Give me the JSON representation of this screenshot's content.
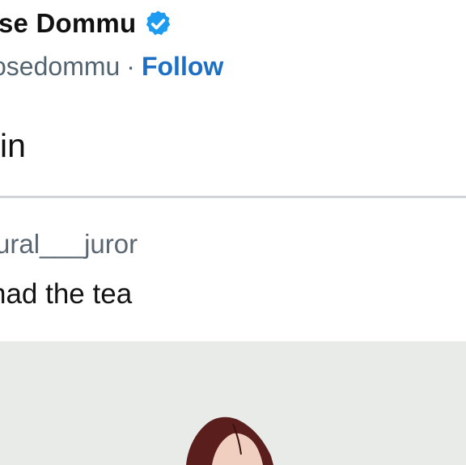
{
  "tweet": {
    "author_name": "se Dommu",
    "author_handle": "osedommu",
    "separator": "·",
    "follow_label": "Follow",
    "verified_icon": "verified-badge-icon",
    "text": "in"
  },
  "quote": {
    "handle": "ural___juror",
    "text": "had the tea"
  },
  "media": {
    "description_icon": "cartoon-illustration",
    "background_color": "#e9ebe8",
    "hair_color": "#5a1f1c"
  },
  "colors": {
    "link_blue": "#1d6ec5",
    "verified_blue": "#1d9bf0",
    "secondary_text": "#536471",
    "divider": "#cfd4d8"
  }
}
